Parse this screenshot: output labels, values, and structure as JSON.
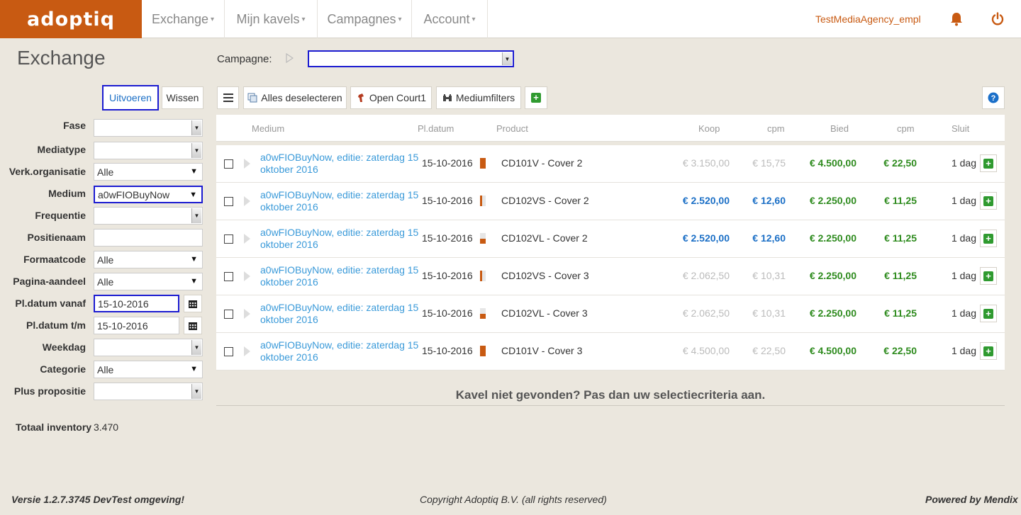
{
  "app": {
    "logo": "adoptiq"
  },
  "nav": {
    "items": [
      {
        "label": "Exchange"
      },
      {
        "label": "Mijn kavels"
      },
      {
        "label": "Campagnes"
      },
      {
        "label": "Account"
      }
    ],
    "user": "TestMediaAgency_empl"
  },
  "page": {
    "title": "Exchange"
  },
  "campaign": {
    "label": "Campagne:",
    "value": ""
  },
  "filter_buttons": {
    "run": "Uitvoeren",
    "clear": "Wissen"
  },
  "filters": [
    {
      "label": "Fase",
      "value": "",
      "kind": "select-grey"
    },
    {
      "label": "Mediatype",
      "value": "",
      "kind": "select-grey"
    },
    {
      "label": "Verk.organisatie",
      "value": "Alle",
      "kind": "select"
    },
    {
      "label": "Medium",
      "value": "a0wFIOBuyNow",
      "kind": "select"
    },
    {
      "label": "Frequentie",
      "value": "",
      "kind": "select-grey"
    },
    {
      "label": "Positienaam",
      "value": "",
      "kind": "text"
    },
    {
      "label": "Formaatcode",
      "value": "Alle",
      "kind": "select"
    },
    {
      "label": "Pagina-aandeel",
      "value": "Alle",
      "kind": "select"
    },
    {
      "label": "Pl.datum vanaf",
      "value": "15-10-2016",
      "kind": "date"
    },
    {
      "label": "Pl.datum t/m",
      "value": "15-10-2016",
      "kind": "date"
    },
    {
      "label": "Weekdag",
      "value": "",
      "kind": "select-grey"
    },
    {
      "label": "Categorie",
      "value": "Alle",
      "kind": "select"
    },
    {
      "label": "Plus propositie",
      "value": "",
      "kind": "select-grey"
    }
  ],
  "toolbar": {
    "deselect": "Alles deselecteren",
    "open_court": "Open Court1",
    "medium_filters": "Mediumfilters"
  },
  "columns": {
    "medium": "Medium",
    "date": "Pl.datum",
    "product": "Product",
    "buy": "Koop",
    "buy_cpm": "cpm",
    "bid": "Bied",
    "bid_cpm": "cpm",
    "close": "Sluit"
  },
  "rows": [
    {
      "medium": "a0wFIOBuyNow, editie: zaterdag 15 oktober 2016",
      "date": "15-10-2016",
      "mark": "full",
      "product": "CD101V - Cover 2",
      "buy": "€ 3.150,00",
      "buy_cpm": "€ 15,75",
      "buy_state": "muted",
      "bid": "€ 4.500,00",
      "bid_cpm": "€ 22,50",
      "close": "1 dag"
    },
    {
      "medium": "a0wFIOBuyNow, editie: zaterdag 15 oktober 2016",
      "date": "15-10-2016",
      "mark": "left",
      "product": "CD102VS - Cover 2",
      "buy": "€ 2.520,00",
      "buy_cpm": "€ 12,60",
      "buy_state": "active",
      "bid": "€ 2.250,00",
      "bid_cpm": "€ 11,25",
      "close": "1 dag"
    },
    {
      "medium": "a0wFIOBuyNow, editie: zaterdag 15 oktober 2016",
      "date": "15-10-2016",
      "mark": "bottom",
      "product": "CD102VL - Cover 2",
      "buy": "€ 2.520,00",
      "buy_cpm": "€ 12,60",
      "buy_state": "active",
      "bid": "€ 2.250,00",
      "bid_cpm": "€ 11,25",
      "close": "1 dag"
    },
    {
      "medium": "a0wFIOBuyNow, editie: zaterdag 15 oktober 2016",
      "date": "15-10-2016",
      "mark": "left",
      "product": "CD102VS - Cover 3",
      "buy": "€ 2.062,50",
      "buy_cpm": "€ 10,31",
      "buy_state": "muted",
      "bid": "€ 2.250,00",
      "bid_cpm": "€ 11,25",
      "close": "1 dag"
    },
    {
      "medium": "a0wFIOBuyNow, editie: zaterdag 15 oktober 2016",
      "date": "15-10-2016",
      "mark": "bottom",
      "product": "CD102VL - Cover 3",
      "buy": "€ 2.062,50",
      "buy_cpm": "€ 10,31",
      "buy_state": "muted",
      "bid": "€ 2.250,00",
      "bid_cpm": "€ 11,25",
      "close": "1 dag"
    },
    {
      "medium": "a0wFIOBuyNow, editie: zaterdag 15 oktober 2016",
      "date": "15-10-2016",
      "mark": "full",
      "product": "CD101V - Cover 3",
      "buy": "€ 4.500,00",
      "buy_cpm": "€ 22,50",
      "buy_state": "muted",
      "bid": "€ 4.500,00",
      "bid_cpm": "€ 22,50",
      "close": "1 dag"
    }
  ],
  "not_found": "Kavel niet gevonden? Pas dan uw selectiecriteria aan.",
  "totals": {
    "label": "Totaal inventory",
    "value": "3.470"
  },
  "footer": {
    "version": "Versie 1.2.7.3745 DevTest omgeving!",
    "copyright": "Copyright Adoptiq B.V. (all rights reserved)",
    "powered": "Powered by Mendix"
  },
  "colors": {
    "brand": "#c85a12",
    "link": "#3a9ad9",
    "active_price": "#1b6fc6",
    "muted_price": "#bbbbbb",
    "bid_price": "#2e8b1e",
    "focus": "#1b1bd1"
  },
  "icons": [
    "bell-icon",
    "power-icon",
    "play-icon",
    "list-icon",
    "deselect-icon",
    "court-icon",
    "filter-icon",
    "add-icon",
    "help-icon",
    "calendar-icon"
  ]
}
